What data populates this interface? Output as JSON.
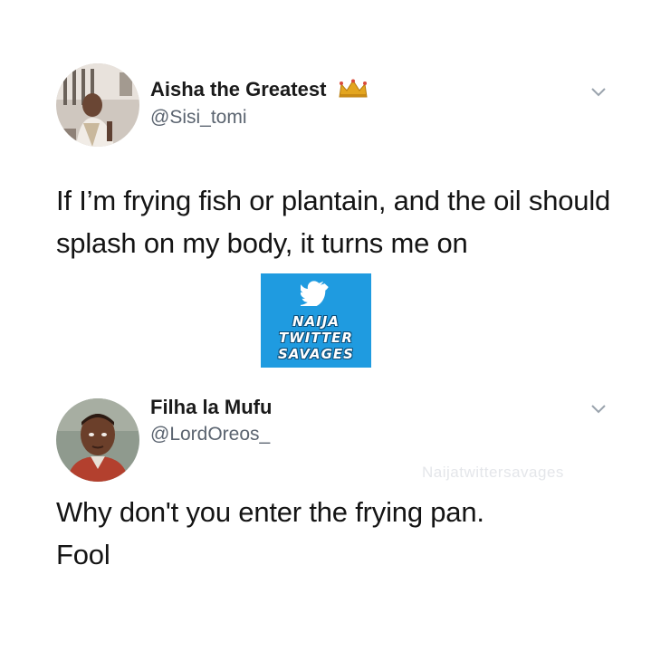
{
  "tweet1": {
    "display_name": "Aisha the Greatest",
    "handle": "@Sisi_tomi",
    "badge_icon": "crown-icon",
    "menu_icon": "chevron-down-icon",
    "text": "If I’m frying fish or plantain, and the oil should splash on my body, it turns me on"
  },
  "watermark": {
    "line1": "NAIJA",
    "line2": "TWITTER",
    "line3": "SAVAGES",
    "icon": "twitter-bird-icon",
    "color": "#1f9be0"
  },
  "tweet2": {
    "display_name": "Filha la Mufu",
    "handle": "@LordOreos_",
    "menu_icon": "chevron-down-icon",
    "text_line1": "Why don't you enter the frying pan.",
    "text_line2": "Fool",
    "faint_watermark": "Naijatwittersavages"
  }
}
